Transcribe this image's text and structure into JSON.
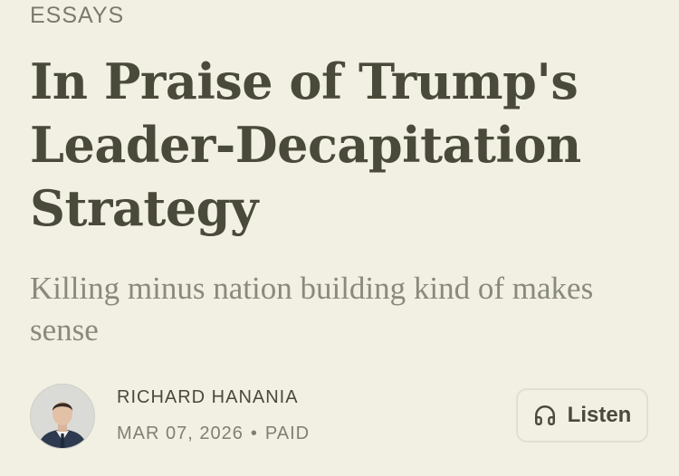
{
  "section": {
    "label": "ESSAYS"
  },
  "article": {
    "title": "In Praise of Trump's Leader-Decapitation Strategy",
    "subtitle": "Killing minus nation building kind of makes sense"
  },
  "byline": {
    "author": "RICHARD HANANIA",
    "date": "MAR 07, 2026",
    "separator": "•",
    "access": "PAID"
  },
  "listen_button": {
    "label": "Listen",
    "icon": "headphones-icon"
  },
  "colors": {
    "background": "#f1f0e3",
    "title_text": "#4a4a3a",
    "muted_text": "#8a8a7c"
  }
}
